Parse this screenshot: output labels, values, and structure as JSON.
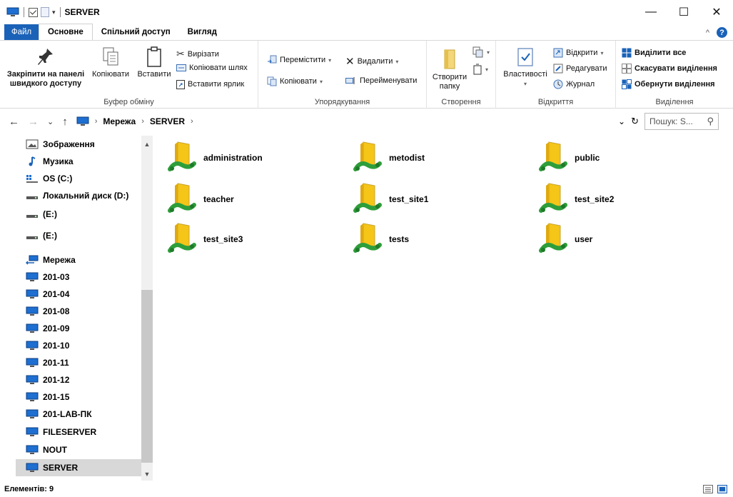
{
  "window": {
    "title": "SERVER",
    "qat_dropdown": "▾",
    "controls": {
      "minimize": "—",
      "maximize": "☐",
      "close": "✕"
    }
  },
  "tabs": [
    {
      "label": "Файл"
    },
    {
      "label": "Основне"
    },
    {
      "label": "Спільний доступ"
    },
    {
      "label": "Вигляд"
    }
  ],
  "ribbon_collapse": "^",
  "help": "?",
  "ribbon": {
    "clipboard": {
      "label": "Буфер обміну",
      "pin_line1": "Закріпити на панелі",
      "pin_line2": "швидкого доступу",
      "copy": "Копіювати",
      "paste": "Вставити",
      "cut": "Вирізати",
      "copy_path": "Копіювати шлях",
      "paste_shortcut": "Вставити ярлик"
    },
    "organize": {
      "label": "Упорядкування",
      "move": "Перемістити",
      "copy_to": "Копіювати",
      "delete": "Видалити",
      "rename": "Перейменувати"
    },
    "new": {
      "label": "Створення",
      "new_folder_line1": "Створити",
      "new_folder_line2": "папку"
    },
    "open": {
      "label": "Відкриття",
      "properties": "Властивості",
      "open": "Відкрити",
      "edit": "Редагувати",
      "history": "Журнал"
    },
    "select": {
      "label": "Виділення",
      "select_all": "Виділити все",
      "select_none": "Скасувати виділення",
      "invert": "Обернути виділення"
    }
  },
  "address": {
    "back": "←",
    "forward": "→",
    "recent": "⌄",
    "up": "↑",
    "crumbs": [
      "Мережа",
      "SERVER"
    ],
    "separator": "›",
    "dropdown": "⌄",
    "refresh": "↻",
    "search_placeholder": "Пошук: S...",
    "search_icon": "⚲"
  },
  "nav": {
    "items": [
      {
        "label": "Зображення",
        "icon": "pictures-icon"
      },
      {
        "label": "Музика",
        "icon": "music-icon"
      },
      {
        "label": "OS (C:)",
        "icon": "os-drive-icon"
      },
      {
        "label": "Локальний диск (D:)",
        "icon": "drive-icon"
      },
      {
        "label": "(E:)",
        "icon": "drive-icon"
      },
      {
        "label": "(E:)",
        "icon": "drive-icon"
      },
      {
        "label": "Мережа",
        "icon": "network-icon"
      },
      {
        "label": "201-03",
        "icon": "computer-icon"
      },
      {
        "label": "201-04",
        "icon": "computer-icon"
      },
      {
        "label": "201-08",
        "icon": "computer-icon"
      },
      {
        "label": "201-09",
        "icon": "computer-icon"
      },
      {
        "label": "201-10",
        "icon": "computer-icon"
      },
      {
        "label": "201-11",
        "icon": "computer-icon"
      },
      {
        "label": "201-12",
        "icon": "computer-icon"
      },
      {
        "label": "201-15",
        "icon": "computer-icon"
      },
      {
        "label": "201-LAB-ПК",
        "icon": "computer-icon"
      },
      {
        "label": "FILESERVER",
        "icon": "computer-icon"
      },
      {
        "label": "NOUT",
        "icon": "computer-icon"
      },
      {
        "label": "SERVER",
        "icon": "computer-icon",
        "selected": true
      }
    ],
    "scroll_up": "▲",
    "scroll_down": "▼"
  },
  "folders": [
    {
      "name": "administration"
    },
    {
      "name": "metodist"
    },
    {
      "name": "public"
    },
    {
      "name": "teacher"
    },
    {
      "name": "test_site1"
    },
    {
      "name": "test_site2"
    },
    {
      "name": "test_site3"
    },
    {
      "name": "tests"
    },
    {
      "name": "user"
    }
  ],
  "status": {
    "item_count": "Елементів: 9"
  },
  "colors": {
    "accent": "#1a62b8",
    "folder": "#f5c518",
    "share_green": "#2e9e3a",
    "selection": "#d8d8d8"
  }
}
